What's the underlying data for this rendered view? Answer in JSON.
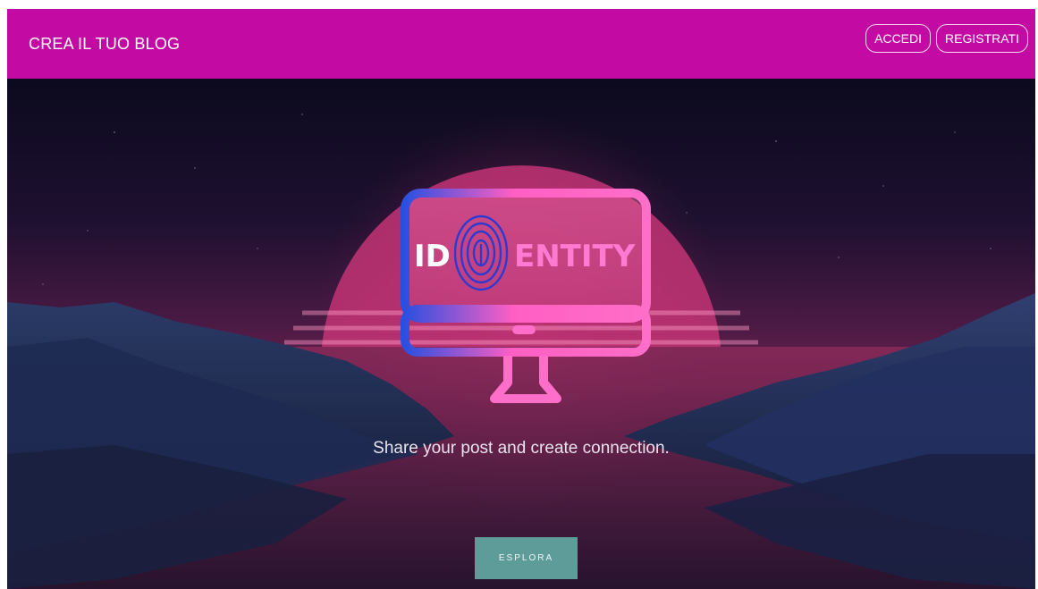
{
  "header": {
    "brand": "CREA IL TUO BLOG",
    "login_label": "ACCEDI",
    "register_label": "REGISTRATI"
  },
  "hero": {
    "logo_text_left": "ID",
    "logo_text_right": "ENTITY",
    "tagline": "Share your post and create connection.",
    "cta_label": "ESPLORA"
  },
  "colors": {
    "header_bg": "#c30ba3",
    "cta_bg": "#5e9c9a",
    "logo_pink": "#ff5fc3",
    "logo_blue": "#3a4fd8"
  }
}
